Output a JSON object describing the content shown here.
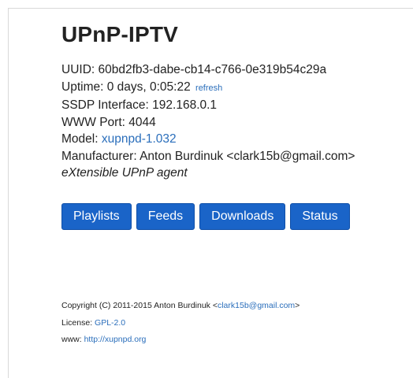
{
  "page": {
    "title": "UPnP-IPTV"
  },
  "info": {
    "uuid_label": "UUID:",
    "uuid_value": "60bd2fb3-dabe-cb14-c766-0e319b54c29a",
    "uptime_label": "Uptime:",
    "uptime_value": "0 days, 0:05:22",
    "refresh_link": "refresh",
    "ssdp_label": "SSDP Interface:",
    "ssdp_value": "192.168.0.1",
    "www_port_label": "WWW Port:",
    "www_port_value": "4044",
    "model_label": "Model:",
    "model_value": "xupnpd-1.032",
    "manufacturer_label": "Manufacturer:",
    "manufacturer_value": "Anton Burdinuk <clark15b@gmail.com>",
    "description": "eXtensible UPnP agent"
  },
  "nav": {
    "playlists": "Playlists",
    "feeds": "Feeds",
    "downloads": "Downloads",
    "status": "Status"
  },
  "footer": {
    "copyright_prefix": "Copyright (C) 2011-2015 Anton Burdinuk <",
    "copyright_email": "clark15b@gmail.com",
    "copyright_suffix": ">",
    "license_label": "License:",
    "license_value": "GPL-2.0",
    "www_label": "www:",
    "www_value": "http://xupnpd.org"
  },
  "colors": {
    "link": "#2a6ebb",
    "button": "#1a64c8",
    "text": "#222222"
  }
}
